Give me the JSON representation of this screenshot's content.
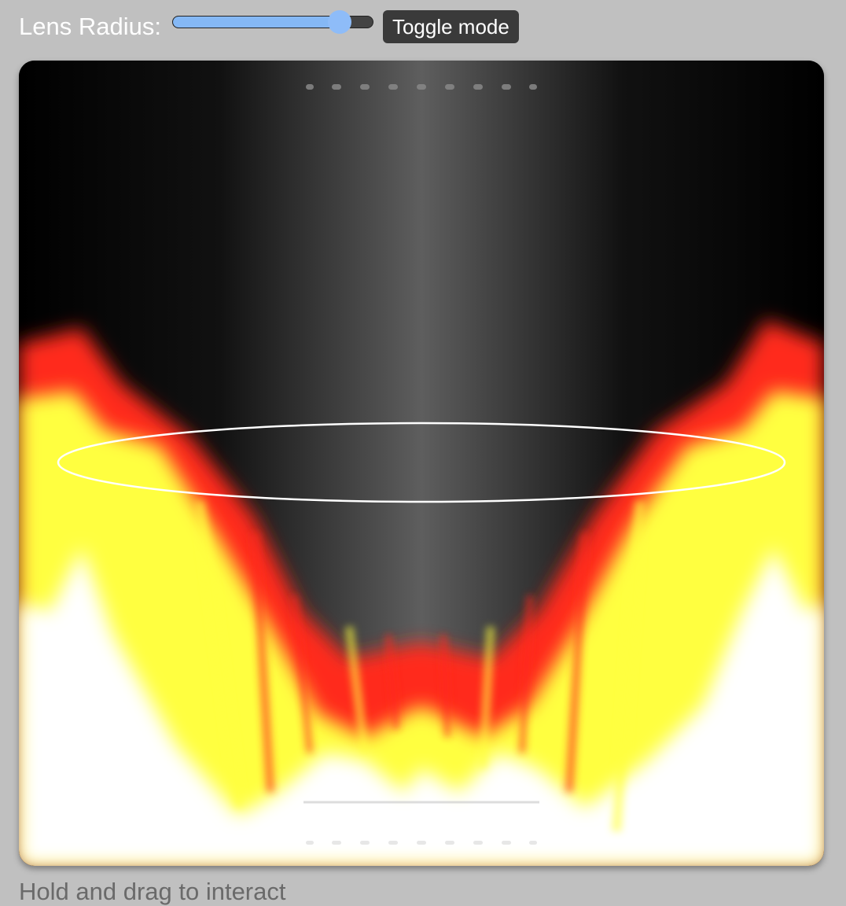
{
  "controls": {
    "lens_radius_label": "Lens Radius:",
    "lens_radius_value": 0.84,
    "toggle_label": "Toggle mode"
  },
  "visualization": {
    "lens_shape": "ellipse",
    "lens_outline_color": "#ffffff",
    "colormap": [
      "#000000",
      "#ff2a1a",
      "#ffff40",
      "#ffffff"
    ],
    "background_color": "#c0c0c0"
  },
  "footer": {
    "hint": "Hold and drag to interact"
  }
}
